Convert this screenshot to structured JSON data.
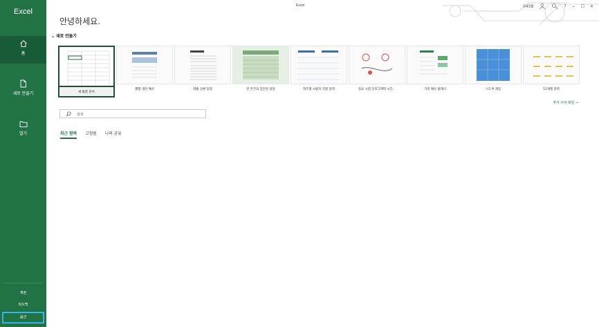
{
  "window": {
    "title": "Excel",
    "account": "0458"
  },
  "titlebar": {
    "help": "?",
    "minimize": "−",
    "restore": "☐",
    "close": "✕"
  },
  "sidebar": {
    "app_name": "Excel",
    "nav": [
      {
        "label": "홈"
      },
      {
        "label": "새로 만들기"
      },
      {
        "label": "열기"
      }
    ],
    "bottom": [
      {
        "label": "계정"
      },
      {
        "label": "피드백"
      },
      {
        "label": "옵션"
      }
    ]
  },
  "main": {
    "greeting": "안녕하세요.",
    "new_section": "새로 만들기",
    "templates": [
      {
        "label": "새 통합 문서"
      },
      {
        "label": "월별 개인 예산"
      },
      {
        "label": "대출 상환 일정"
      },
      {
        "label": "한 주간의 집안일 일정"
      },
      {
        "label": "연도별 사용자 지정 달력"
      },
      {
        "label": "중요 시점 인포그래픽 시간..."
      },
      {
        "label": "가족 예산 플래너"
      },
      {
        "label": "스도쿠 게임"
      },
      {
        "label": "12개월 달력"
      }
    ],
    "more_templates": "추가 서식 파일 →",
    "search_placeholder": "검색",
    "tabs": [
      {
        "label": "최근 항목"
      },
      {
        "label": "고정됨"
      },
      {
        "label": "나와 공유"
      }
    ]
  },
  "colors": {
    "accent": "#217346",
    "accent_dark": "#185c37",
    "focus": "#36b6f0"
  }
}
